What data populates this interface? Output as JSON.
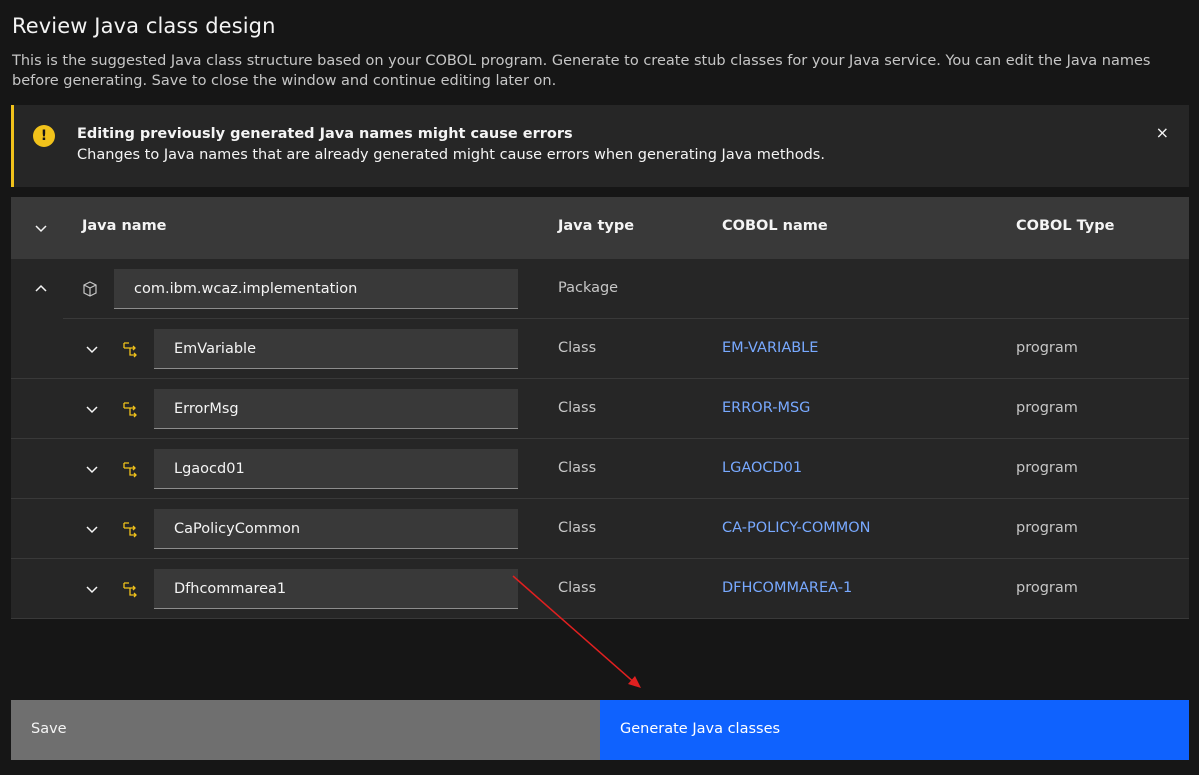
{
  "page": {
    "title": "Review Java class design",
    "description": "This is the suggested Java class structure based on your COBOL program. Generate to create stub classes for your Java service. You can edit the Java names before generating. Save to close the window and continue editing later on."
  },
  "notification": {
    "kind": "warning",
    "title": "Editing previously generated Java names might cause errors",
    "subtitle": "Changes to Java names that are already generated might cause errors when generating Java methods.",
    "close_glyph": "×",
    "color": "#f1c21b"
  },
  "table": {
    "headers": {
      "java_name": "Java name",
      "java_type": "Java type",
      "cobol_name": "COBOL name",
      "cobol_type": "COBOL Type"
    },
    "package": {
      "java_name": "com.ibm.wcaz.implementation",
      "java_type": "Package",
      "icon": "package-icon",
      "expanded": true
    },
    "classes": [
      {
        "java_name": "EmVariable",
        "java_type": "Class",
        "cobol_name": "EM-VARIABLE",
        "cobol_type": "program",
        "icon": "class-hierarchy-icon"
      },
      {
        "java_name": "ErrorMsg",
        "java_type": "Class",
        "cobol_name": "ERROR-MSG",
        "cobol_type": "program",
        "icon": "class-hierarchy-icon"
      },
      {
        "java_name": "Lgaocd01",
        "java_type": "Class",
        "cobol_name": "LGAOCD01",
        "cobol_type": "program",
        "icon": "class-hierarchy-icon"
      },
      {
        "java_name": "CaPolicyCommon",
        "java_type": "Class",
        "cobol_name": "CA-POLICY-COMMON",
        "cobol_type": "program",
        "icon": "class-hierarchy-icon"
      },
      {
        "java_name": "Dfhcommarea1",
        "java_type": "Class",
        "cobol_name": "DFHCOMMAREA-1",
        "cobol_type": "program",
        "icon": "class-hierarchy-icon"
      }
    ]
  },
  "footer": {
    "save_label": "Save",
    "generate_label": "Generate Java classes"
  },
  "colors": {
    "background": "#161616",
    "primary": "#0f62fe",
    "secondary": "#6f6f6f",
    "link": "#78a9ff",
    "class_icon": "#f1c21b",
    "annotation_arrow": "#e02020"
  }
}
